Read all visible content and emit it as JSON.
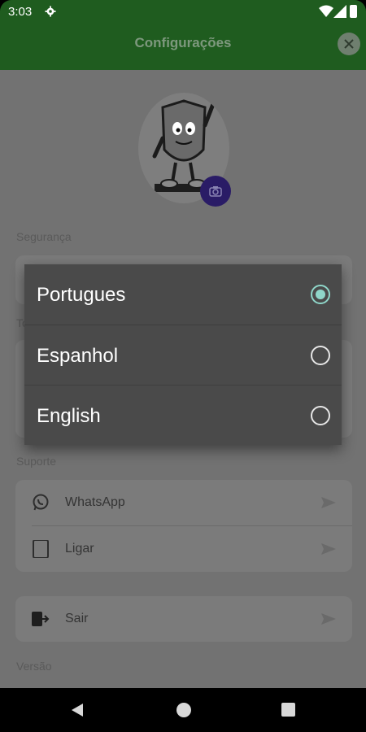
{
  "status": {
    "time": "3:03"
  },
  "appbar": {
    "title": "Configurações"
  },
  "sections": {
    "security": "Segurança",
    "theme_fragment": "To",
    "support": "Suporte",
    "version": "Versão"
  },
  "support_items": [
    {
      "label": "WhatsApp",
      "icon": "whatsapp-icon"
    },
    {
      "label": "Ligar",
      "icon": "phone-icon"
    }
  ],
  "logout": {
    "label": "Sair",
    "icon": "logout-icon"
  },
  "language_dialog": {
    "options": [
      {
        "label": "Portugues",
        "selected": true
      },
      {
        "label": "Espanhol",
        "selected": false
      },
      {
        "label": "English",
        "selected": false
      }
    ],
    "accent": "#8fd6c9"
  },
  "colors": {
    "appbar": "#1f5c1f",
    "camera_button": "#2a1c66"
  }
}
